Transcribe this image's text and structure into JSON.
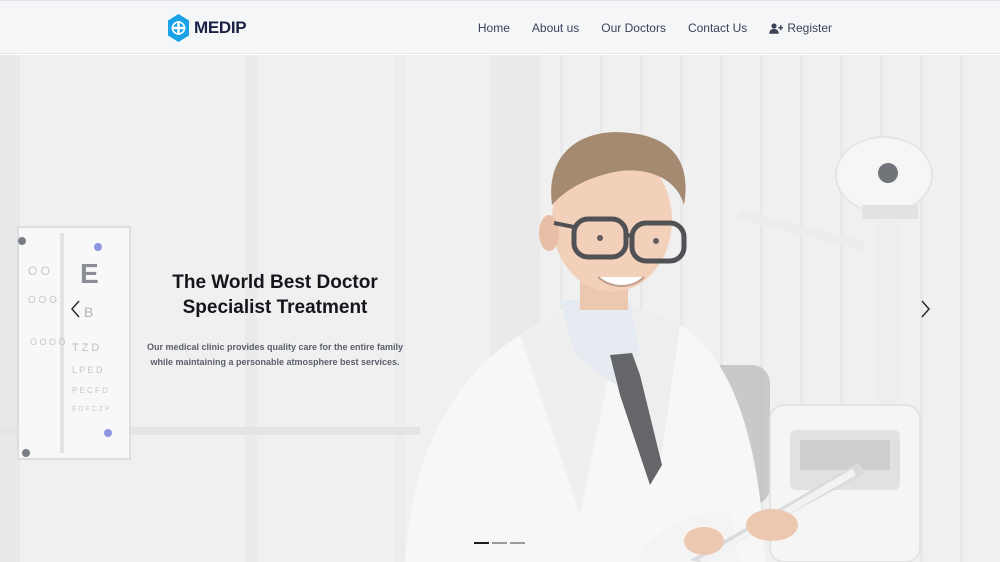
{
  "brand": {
    "name": "MEDIP",
    "logo_icon": "medical-cross-hexagon-icon",
    "logo_color": "#1aa3e8"
  },
  "nav": {
    "items": [
      {
        "label": "Home"
      },
      {
        "label": "About us"
      },
      {
        "label": "Our Doctors"
      },
      {
        "label": "Contact Us"
      }
    ],
    "register": {
      "label": "Register",
      "icon": "user-plus-icon"
    }
  },
  "hero": {
    "title_line1": "The World Best Doctor",
    "title_line2": "Specialist Treatment",
    "description_line1": "Our medical clinic provides quality care for the entire family",
    "description_line2": "while maintaining a personable atmosphere best services.",
    "prev_icon": "chevron-left-icon",
    "next_icon": "chevron-right-icon",
    "slides_count": 3,
    "active_slide": 1
  },
  "colors": {
    "brand_text": "#1a2244",
    "nav_text": "#3c4257",
    "title_text": "#14161c"
  }
}
